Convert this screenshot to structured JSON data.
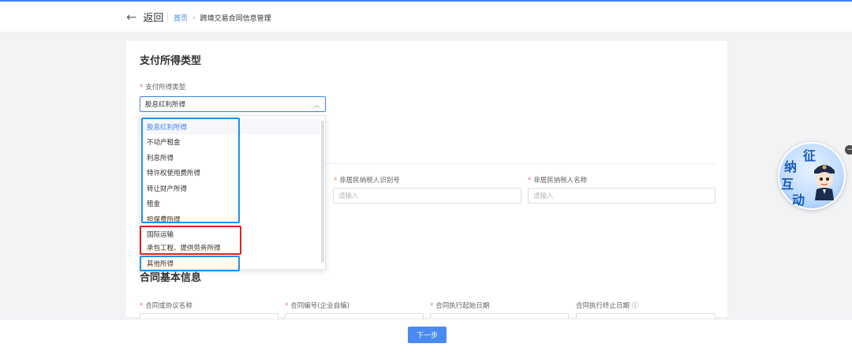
{
  "header": {
    "back_label": "返回",
    "breadcrumb_home": "首页",
    "breadcrumb_separator": "›",
    "breadcrumb_current": "跨境交易合同信息管理"
  },
  "section_payment": {
    "title": "支付所得类型",
    "field_label": "支付所得类型",
    "selected_value": "股息红利所得"
  },
  "dropdown": {
    "options": [
      {
        "label": "股息红利所得",
        "selected": true
      },
      {
        "label": "不动产租金",
        "selected": false
      },
      {
        "label": "利息所得",
        "selected": false
      },
      {
        "label": "特许权使用费所得",
        "selected": false
      },
      {
        "label": "转让财产所得",
        "selected": false
      },
      {
        "label": "租金",
        "selected": false
      },
      {
        "label": "担保费所得",
        "selected": false
      },
      {
        "label": "国际运输",
        "selected": false
      },
      {
        "label": "承包工程、提供劳务所得",
        "selected": false
      },
      {
        "label": "其他所得",
        "selected": false
      }
    ],
    "highlight_colors": {
      "blue": "#1f8fea",
      "red": "#e0201b"
    }
  },
  "taxpayer": {
    "id_label": "非居民纳税人识别号",
    "id_placeholder": "请输入",
    "name_label": "非居民纳税人名称",
    "name_placeholder": "请输入"
  },
  "section_contract": {
    "title": "合同基本信息",
    "fields": [
      {
        "label": "合同或协议名称",
        "required": true
      },
      {
        "label": "合同编号(企业自编)",
        "required": true
      },
      {
        "label": "合同执行起始日期",
        "required": true
      },
      {
        "label": "合同执行终止日期",
        "required": false,
        "info_icon": "ⓘ"
      }
    ]
  },
  "footer": {
    "next_label": "下一步"
  },
  "widget": {
    "chars": [
      "征",
      "纳",
      "互",
      "动"
    ],
    "close_icon": "−"
  },
  "colors": {
    "accent": "#3d7ff0",
    "required": "#f56c6c"
  }
}
